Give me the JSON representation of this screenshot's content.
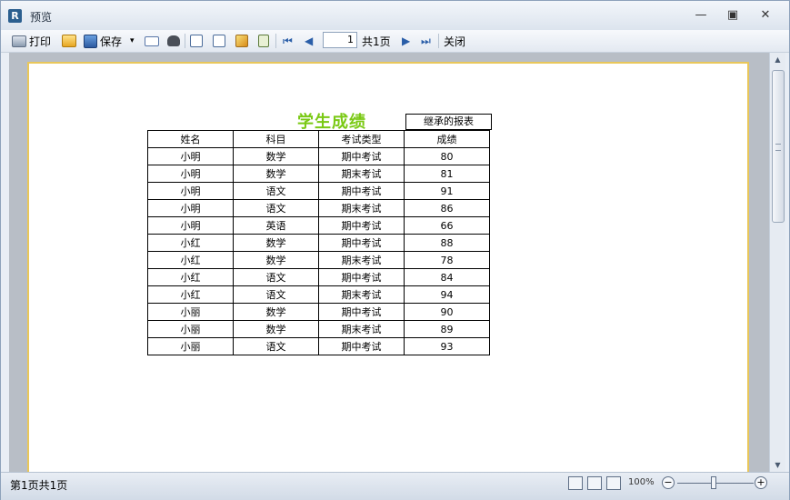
{
  "window": {
    "title": "预览"
  },
  "toolbar": {
    "print_label": "打印",
    "save_label": "保存",
    "save_dropdown": "▾",
    "page_value": "1",
    "page_total": "共1页",
    "close_label": "关闭"
  },
  "report": {
    "title": "学生成绩",
    "inherit_label": "继承的报表",
    "title_color": "#7ac914",
    "columns": [
      "姓名",
      "科目",
      "考试类型",
      "成绩"
    ],
    "rows": [
      [
        "小明",
        "数学",
        "期中考试",
        "80"
      ],
      [
        "小明",
        "数学",
        "期末考试",
        "81"
      ],
      [
        "小明",
        "语文",
        "期中考试",
        "91"
      ],
      [
        "小明",
        "语文",
        "期末考试",
        "86"
      ],
      [
        "小明",
        "英语",
        "期中考试",
        "66"
      ],
      [
        "小红",
        "数学",
        "期中考试",
        "88"
      ],
      [
        "小红",
        "数学",
        "期末考试",
        "78"
      ],
      [
        "小红",
        "语文",
        "期中考试",
        "84"
      ],
      [
        "小红",
        "语文",
        "期末考试",
        "94"
      ],
      [
        "小丽",
        "数学",
        "期中考试",
        "90"
      ],
      [
        "小丽",
        "数学",
        "期末考试",
        "89"
      ],
      [
        "小丽",
        "语文",
        "期中考试",
        "93"
      ]
    ]
  },
  "status": {
    "page_info": "第1页共1页",
    "zoom": "100%"
  }
}
